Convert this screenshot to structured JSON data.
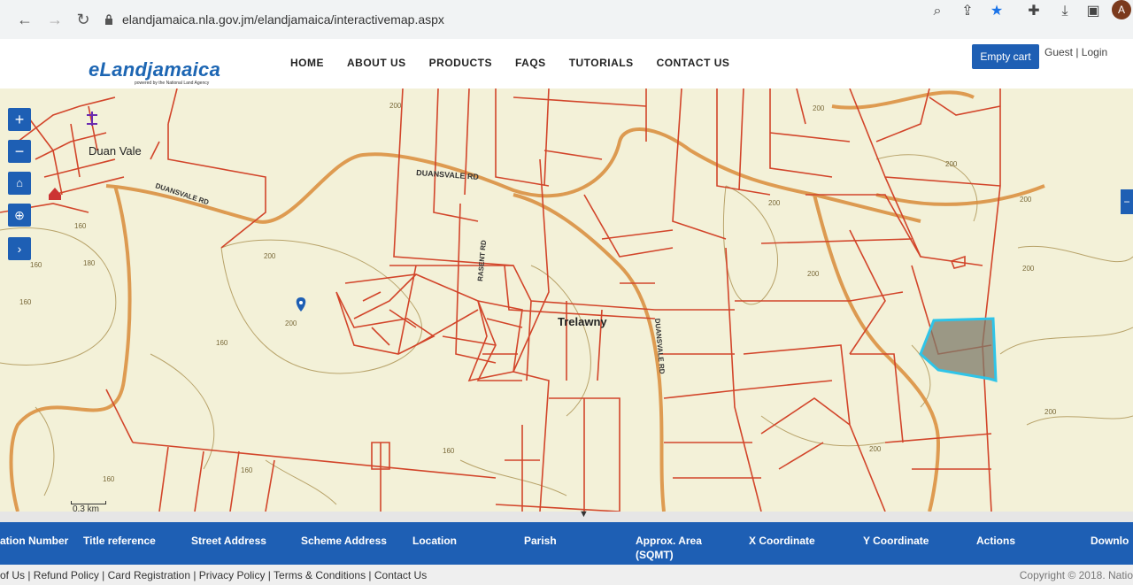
{
  "browser": {
    "url": "elandjamaica.nla.gov.jm/elandjamaica/interactivemap.aspx",
    "avatar_letter": "A"
  },
  "site": {
    "logo": "eLandjamaica",
    "logo_sub": "powered by the National Land Agency",
    "menu": [
      "HOME",
      "ABOUT US",
      "PRODUCTS",
      "FAQS",
      "TUTORIALS",
      "CONTACT US"
    ],
    "cart_label": "Empty cart",
    "auth_text": "Guest | Login"
  },
  "map": {
    "controls": [
      "+",
      "−",
      "home-icon",
      "locate-icon",
      "next-icon"
    ],
    "labels": {
      "place": "Duan Vale",
      "parish": "Trelawny",
      "road1": "DUANSVALE RD",
      "road2": "DUANSVALE RD",
      "road3": "RASENT RD",
      "road4": "DUANSVALE RD"
    },
    "contour_labels": [
      "200",
      "200",
      "200",
      "200",
      "200",
      "200",
      "200",
      "200",
      "200",
      "200",
      "200",
      "160",
      "160",
      "160",
      "160",
      "160",
      "180",
      "160",
      "160"
    ],
    "scale": "0.3 km",
    "accent": "#1e5fb4",
    "parcel_line": "#d2452a",
    "selected_parcel": "#2fc4e8"
  },
  "results": {
    "headers": [
      "ation Number",
      "Title reference",
      "Street Address",
      "Scheme Address",
      "Location",
      "Parish",
      "Approx. Area",
      "X Coordinate",
      "Y Coordinate",
      "Actions",
      "Downlo"
    ],
    "area_unit": "(SQMT)"
  },
  "footer": {
    "links": "of Us | Refund Policy | Card Registration | Privacy Policy | Terms & Conditions | Contact Us",
    "copyright": "Copyright © 2018. Natio"
  }
}
